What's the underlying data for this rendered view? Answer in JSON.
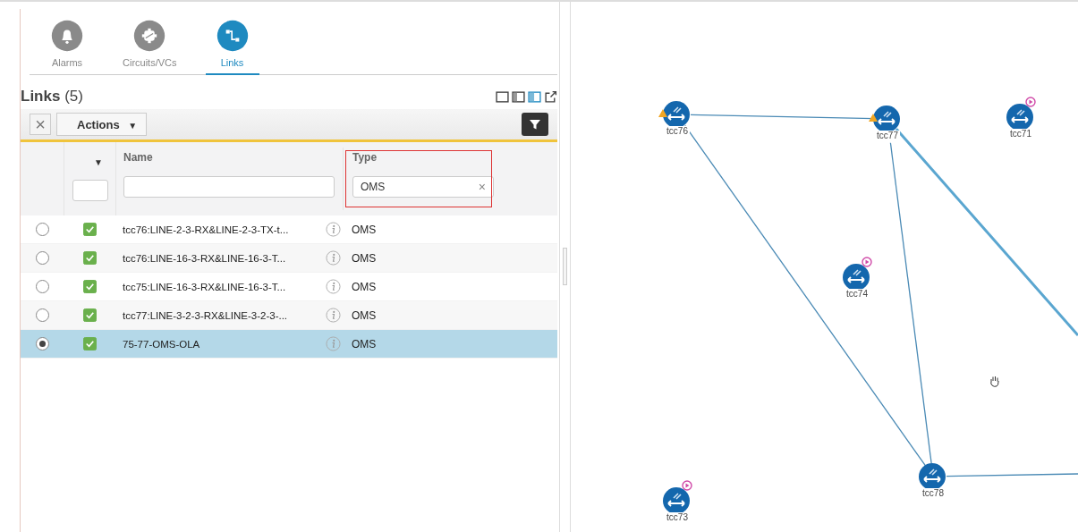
{
  "tabs": [
    {
      "label": "Alarms",
      "selected": false
    },
    {
      "label": "Circuits/VCs",
      "selected": false
    },
    {
      "label": "Links",
      "selected": true
    }
  ],
  "panel": {
    "title": "Links",
    "count": "(5)",
    "actions_label": "Actions",
    "actions_caret": "▼",
    "clear_symbol": "×"
  },
  "table": {
    "sort_caret": "▼",
    "columns": [
      {
        "label": "Name",
        "highlighted": false
      },
      {
        "label": "Type",
        "highlighted": true
      }
    ],
    "filters": {
      "type": "OMS",
      "clear_symbol": "×"
    },
    "rows": [
      {
        "selected": false,
        "checked": true,
        "name": "tcc76:LINE-2-3-RX&LINE-2-3-TX-t...",
        "type": "OMS"
      },
      {
        "selected": false,
        "checked": true,
        "name": "tcc76:LINE-16-3-RX&LINE-16-3-T...",
        "type": "OMS"
      },
      {
        "selected": false,
        "checked": true,
        "name": "tcc75:LINE-16-3-RX&LINE-16-3-T...",
        "type": "OMS"
      },
      {
        "selected": false,
        "checked": true,
        "name": "tcc77:LINE-3-2-3-RX&LINE-3-2-3-...",
        "type": "OMS"
      },
      {
        "selected": true,
        "checked": true,
        "name": "75-77-OMS-OLA",
        "type": "OMS"
      }
    ]
  },
  "map": {
    "nodes": [
      {
        "label": "tcc76",
        "alarm": true,
        "badge": false
      },
      {
        "label": "tcc77",
        "alarm": true,
        "badge": false
      },
      {
        "label": "tcc71",
        "alarm": false,
        "badge": true
      },
      {
        "label": "tcc74",
        "alarm": false,
        "badge": true
      },
      {
        "label": "tcc78",
        "alarm": false,
        "badge": false
      },
      {
        "label": "tcc73",
        "alarm": false,
        "badge": true
      }
    ]
  }
}
